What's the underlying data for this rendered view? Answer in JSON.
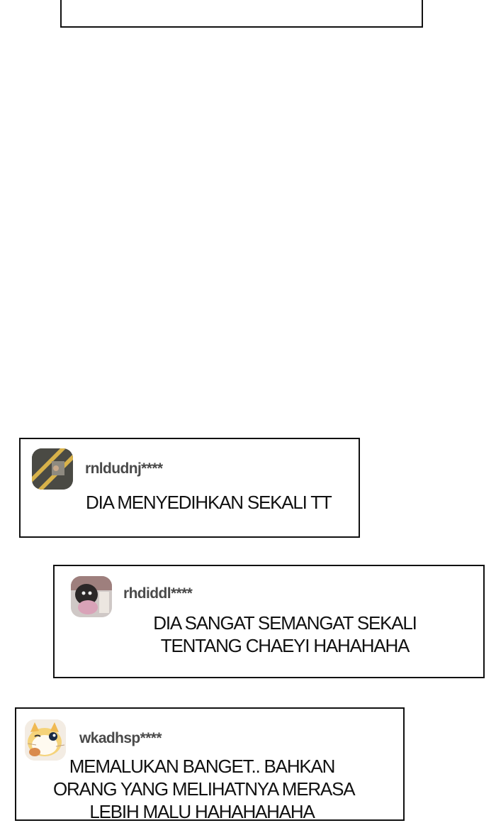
{
  "comments": [
    {
      "username": "rnldudnj****",
      "lines": [
        "DIA MENYEDIHKAN SEKALI TT"
      ],
      "avatar_icon": "striped-tape-photo-icon"
    },
    {
      "username": "rhdiddl****",
      "lines": [
        "DIA SANGAT SEMANGAT SEKALI",
        "TENTANG CHAEYI HAHAHAHA"
      ],
      "avatar_icon": "dog-photo-icon"
    },
    {
      "username": "wkadhsp****",
      "lines": [
        "MEMALUKAN BANGET.. BAHKAN",
        "ORANG YANG MELIHATNYA MERASA",
        "LEBIH MALU HAHAHAHAHA"
      ],
      "avatar_icon": "cat-illustration-icon"
    }
  ]
}
